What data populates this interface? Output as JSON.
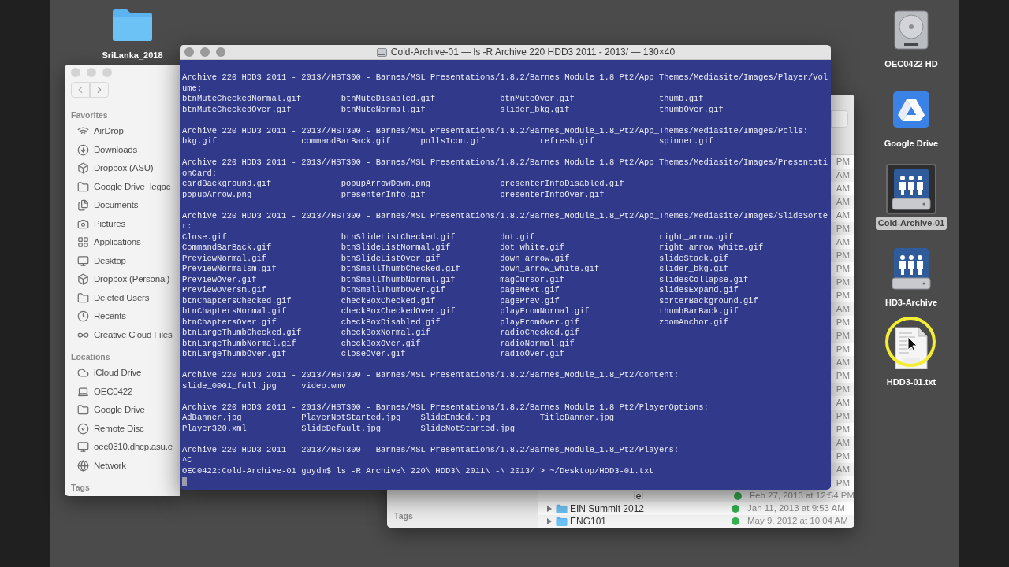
{
  "desktop": {
    "left_icons": [
      {
        "label": "SriLanka_2018",
        "selected": false
      }
    ],
    "right_icons": [
      {
        "label": "OEC0422 HD",
        "selected": false
      },
      {
        "label": "Google Drive",
        "selected": false
      },
      {
        "label": "Cold-Archive-01",
        "selected": true
      },
      {
        "label": "HD3-Archive",
        "selected": false
      },
      {
        "label": "HDD3-01.txt",
        "selected": false
      }
    ]
  },
  "finder_back": {
    "sidebar": {
      "section": "Tags"
    },
    "date_fragments": [
      "PM",
      "AM",
      "AM",
      "AM",
      "AM",
      "PM",
      "AM",
      "PM",
      "PM",
      "PM",
      "PM",
      "AM",
      "PM",
      "PM",
      "PM",
      "AM",
      "PM",
      "PM",
      "AM",
      "PM",
      "PM",
      "AM",
      "PM",
      "AM",
      "PM"
    ],
    "partial_row": {
      "name": "iel",
      "date": "Feb 27, 2013 at 12:54 PM"
    },
    "rows": [
      {
        "name": "EIN Summit 2012",
        "date": "Jan 11, 2013 at 9:53 AM",
        "expanded": false
      },
      {
        "name": "ENG101",
        "date": "May 9, 2012 at 10:04 AM",
        "expanded": false
      }
    ]
  },
  "finder_front": {
    "sections": [
      {
        "title": "Favorites",
        "items": [
          {
            "label": "AirDrop"
          },
          {
            "label": "Downloads"
          },
          {
            "label": "Dropbox (ASU)"
          },
          {
            "label": "Google Drive_legac"
          },
          {
            "label": "Documents"
          },
          {
            "label": "Pictures"
          },
          {
            "label": "Applications"
          },
          {
            "label": "Desktop"
          },
          {
            "label": "Dropbox (Personal)"
          },
          {
            "label": "Deleted Users"
          },
          {
            "label": "Recents"
          },
          {
            "label": "Creative Cloud Files"
          }
        ]
      },
      {
        "title": "Locations",
        "items": [
          {
            "label": "iCloud Drive"
          },
          {
            "label": "OEC0422"
          },
          {
            "label": "Google Drive"
          },
          {
            "label": "Remote Disc"
          },
          {
            "label": "oec0310.dhcp.asu.e"
          },
          {
            "label": "Network"
          }
        ]
      },
      {
        "title": "Tags"
      }
    ]
  },
  "terminal": {
    "title": "Cold-Archive-01 — ls -R Archive 220 HDD3 2011 - 2013/ — 130×40",
    "blocks": [
      {
        "lines": [
          "Archive 220 HDD3 2011 - 2013//HST300 - Barnes/MSL Presentations/1.8.2/Barnes_Module_1.8_Pt2/App_Themes/Mediasite/Images/Player/Vol",
          "ume:"
        ],
        "rows": [
          [
            "btnMuteCheckedNormal.gif",
            "btnMuteDisabled.gif",
            "btnMuteOver.gif",
            "thumb.gif"
          ],
          [
            "btnMuteCheckedOver.gif",
            "btnMuteNormal.gif",
            "slider_bkg.gif",
            "thumbOver.gif"
          ]
        ]
      },
      {
        "lines": [
          "Archive 220 HDD3 2011 - 2013//HST300 - Barnes/MSL Presentations/1.8.2/Barnes_Module_1.8_Pt2/App_Themes/Mediasite/Images/Polls:"
        ],
        "rows": [
          [
            "bkg.gif",
            "commandBarBack.gif",
            "pollsIcon.gif",
            "refresh.gif",
            "spinner.gif"
          ]
        ]
      },
      {
        "lines": [
          "Archive 220 HDD3 2011 - 2013//HST300 - Barnes/MSL Presentations/1.8.2/Barnes_Module_1.8_Pt2/App_Themes/Mediasite/Images/Presentati",
          "onCard:"
        ],
        "rows": [
          [
            "cardBackground.gif",
            "popupArrowDown.png",
            "presenterInfoDisabled.gif"
          ],
          [
            "popupArrow.png",
            "presenterInfo.gif",
            "presenterInfoOver.gif"
          ]
        ]
      },
      {
        "lines": [
          "Archive 220 HDD3 2011 - 2013//HST300 - Barnes/MSL Presentations/1.8.2/Barnes_Module_1.8_Pt2/App_Themes/Mediasite/Images/SlideSorte",
          "r:"
        ],
        "rows": [
          [
            "Close.gif",
            "btnSlideListChecked.gif",
            "dot.gif",
            "right_arrow.gif"
          ],
          [
            "CommandBarBack.gif",
            "btnSlideListNormal.gif",
            "dot_white.gif",
            "right_arrow_white.gif"
          ],
          [
            "PreviewNormal.gif",
            "btnSlideListOver.gif",
            "down_arrow.gif",
            "slideStack.gif"
          ],
          [
            "PreviewNormalsm.gif",
            "btnSmallThumbChecked.gif",
            "down_arrow_white.gif",
            "slider_bkg.gif"
          ],
          [
            "PreviewOver.gif",
            "btnSmallThumbNormal.gif",
            "magCursor.gif",
            "slidesCollapse.gif"
          ],
          [
            "PreviewOversm.gif",
            "btnSmallThumbOver.gif",
            "pageNext.gif",
            "slidesExpand.gif"
          ],
          [
            "btnChaptersChecked.gif",
            "checkBoxChecked.gif",
            "pagePrev.gif",
            "sorterBackground.gif"
          ],
          [
            "btnChaptersNormal.gif",
            "checkBoxCheckedOver.gif",
            "playFromNormal.gif",
            "thumbBarBack.gif"
          ],
          [
            "btnChaptersOver.gif",
            "checkBoxDisabled.gif",
            "playFromOver.gif",
            "zoomAnchor.gif"
          ],
          [
            "btnLargeThumbChecked.gif",
            "checkBoxNormal.gif",
            "radioChecked.gif"
          ],
          [
            "btnLargeThumbNormal.gif",
            "checkBoxOver.gif",
            "radioNormal.gif"
          ],
          [
            "btnLargeThumbOver.gif",
            "closeOver.gif",
            "radioOver.gif"
          ]
        ]
      },
      {
        "lines": [
          "Archive 220 HDD3 2011 - 2013//HST300 - Barnes/MSL Presentations/1.8.2/Barnes_Module_1.8_Pt2/Content:"
        ],
        "rows": [
          [
            "slide_0001_full.jpg",
            "video.wmv"
          ]
        ]
      },
      {
        "lines": [
          "Archive 220 HDD3 2011 - 2013//HST300 - Barnes/MSL Presentations/1.8.2/Barnes_Module_1.8_Pt2/PlayerOptions:"
        ],
        "rows": [
          [
            "AdBanner.jpg",
            "PlayerNotStarted.jpg",
            "SlideEnded.jpg",
            "TitleBanner.jpg"
          ],
          [
            "Player320.xml",
            "SlideDefault.jpg",
            "SlideNotStarted.jpg"
          ]
        ]
      },
      {
        "lines": [
          "Archive 220 HDD3 2011 - 2013//HST300 - Barnes/MSL Presentations/1.8.2/Barnes_Module_1.8_Pt2/Players:",
          "^C",
          "OEC0422:Cold-Archive-01 guydm$ ls -R Archive\\ 220\\ HDD3\\ 2011\\ -\\ 2013/ > ~/Desktop/HDD3-01.txt"
        ]
      }
    ]
  }
}
